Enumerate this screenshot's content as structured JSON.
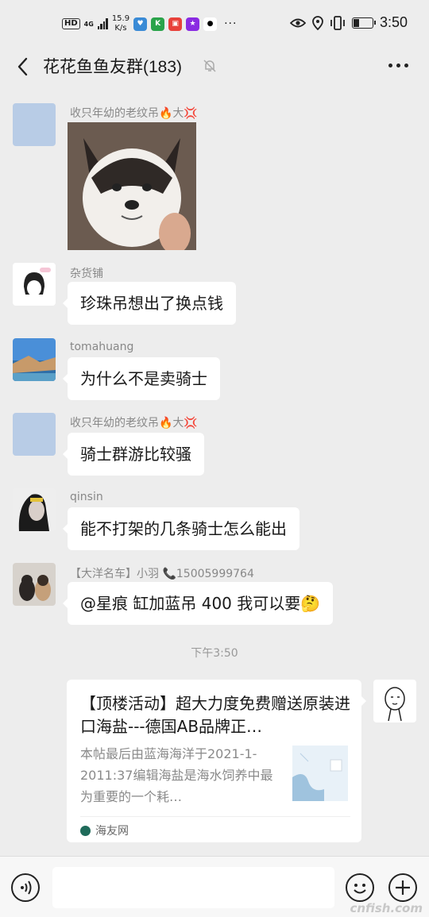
{
  "status_bar": {
    "hd": "HD",
    "network": "4G",
    "speed_value": "15.9",
    "speed_unit": "K/s",
    "time": "3:50",
    "app_icons": [
      "hearts-app-icon",
      "k-app-icon",
      "red-app-icon",
      "purple-app-icon",
      "penguin-app-icon"
    ],
    "more": "···"
  },
  "header": {
    "title": "花花鱼鱼友群(183)",
    "back_icon": "chevron-left-icon",
    "mute_icon": "bell-muted-icon",
    "more_icon": "more-dots-icon"
  },
  "messages": [
    {
      "nickname": "收只年幼的老纹吊🔥大💢",
      "type": "image",
      "image": "husky-photo"
    },
    {
      "nickname": "杂货铺",
      "type": "text",
      "text": "珍珠吊想出了换点钱"
    },
    {
      "nickname": "tomahuang",
      "type": "text",
      "text": "为什么不是卖骑士"
    },
    {
      "nickname": "收只年幼的老纹吊🔥大💢",
      "type": "text",
      "text": "骑士群游比较骚"
    },
    {
      "nickname": "qinsin",
      "type": "text",
      "text": "能不打架的几条骑士怎么能出"
    },
    {
      "nickname": "【大洋名车】小羽 📞15005999764",
      "type": "text",
      "text": "@星痕  缸加蓝吊 400 我可以要🤔"
    }
  ],
  "timestamp": "下午3:50",
  "link_card": {
    "title": "【顶楼活动】超大力度免费赠送原装进口海盐---德国AB品牌正…",
    "description": "本帖最后由蓝海海洋于2021-1-2011:37编辑海盐是海水饲养中最为重要的一个耗…",
    "source": "海友网"
  },
  "input_bar": {
    "voice_icon": "voice-icon",
    "emoji_icon": "emoji-icon",
    "plus_icon": "plus-icon"
  },
  "watermark": "cnfish.com",
  "colors": {
    "background": "#ededed",
    "bubble": "#ffffff",
    "nickname": "#888888"
  }
}
